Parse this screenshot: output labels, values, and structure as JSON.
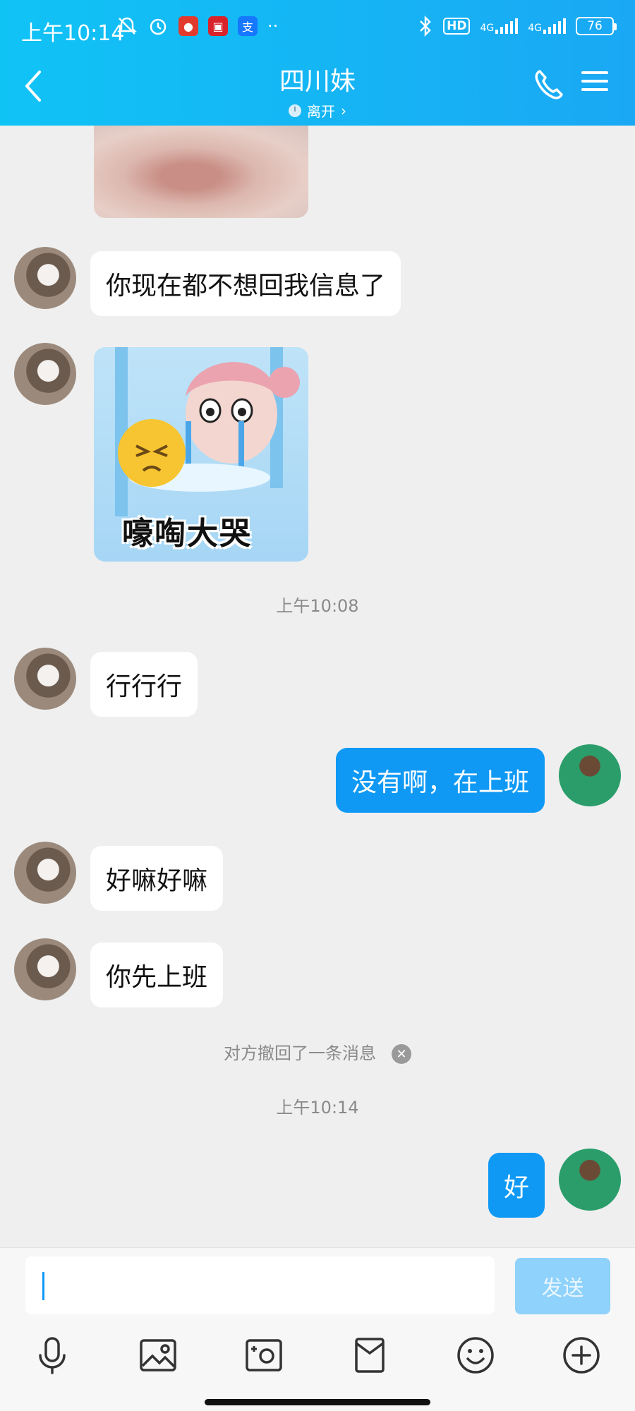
{
  "status_bar": {
    "time": "上午10:14",
    "dots": "··",
    "hd": "HD",
    "network1": "4G",
    "network2": "4G",
    "battery": "76"
  },
  "header": {
    "title": "四川妹",
    "presence": "离开",
    "presence_chevron": "›"
  },
  "messages": [
    {
      "from": "her",
      "type": "text",
      "text": "你现在都不想回我信息了"
    },
    {
      "from": "her",
      "type": "sticker",
      "caption": "嚎啕大哭"
    },
    {
      "type": "timestamp",
      "text": "上午10:08"
    },
    {
      "from": "her",
      "type": "text",
      "text": "行行行"
    },
    {
      "from": "me",
      "type": "text",
      "text": "没有啊，在上班"
    },
    {
      "from": "her",
      "type": "text",
      "text": "好嘛好嘛"
    },
    {
      "from": "her",
      "type": "text",
      "text": "你先上班"
    },
    {
      "type": "recall",
      "text": "对方撤回了一条消息"
    },
    {
      "type": "timestamp",
      "text": "上午10:14"
    },
    {
      "from": "me",
      "type": "text",
      "text": "好"
    }
  ],
  "composer": {
    "input_value": "",
    "send_label": "发送",
    "tools": [
      "microphone-icon",
      "image-icon",
      "camera-icon",
      "red-packet-icon",
      "emoji-icon",
      "plus-icon"
    ]
  },
  "colors": {
    "header": "#14b4f5",
    "bubble_out": "#0f99f5",
    "bubble_in": "#ffffff",
    "send_disabled": "#8fd2fb",
    "background": "#efefef"
  }
}
